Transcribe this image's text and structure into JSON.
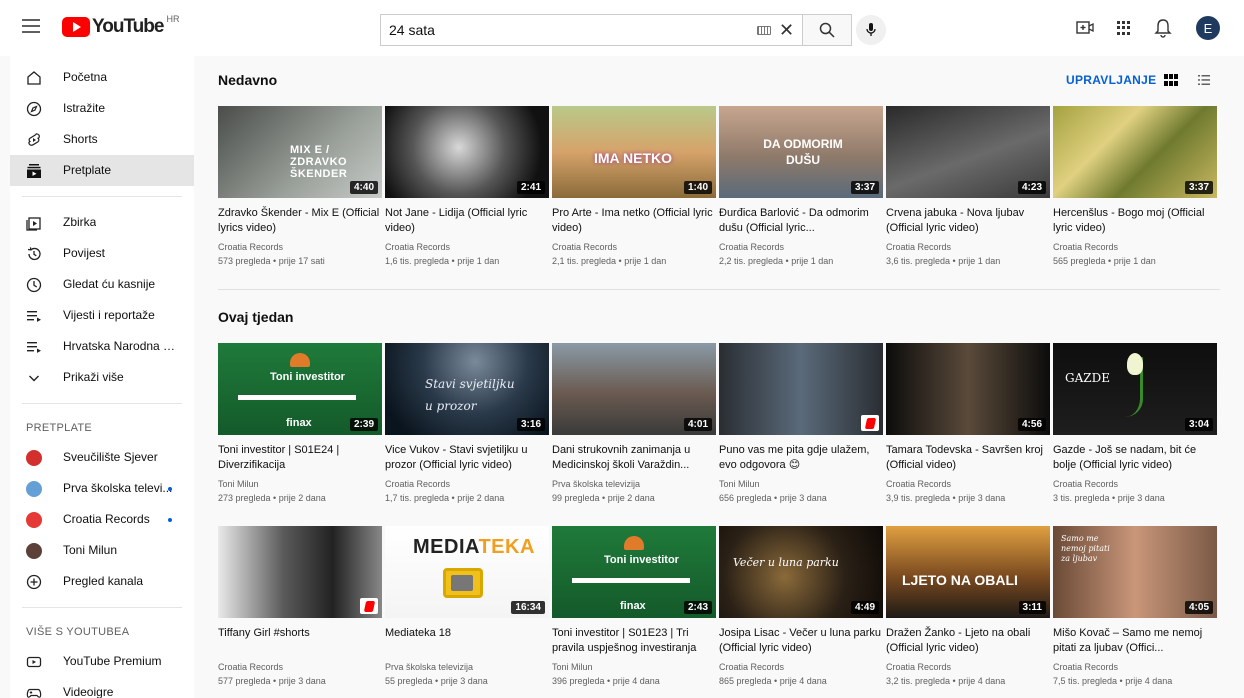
{
  "header": {
    "logo_text": "YouTube",
    "region": "HR",
    "search_value": "24 sata",
    "avatar_letter": "E"
  },
  "sidebar": {
    "main": [
      {
        "label": "Početna",
        "icon": "home-icon"
      },
      {
        "label": "Istražite",
        "icon": "compass-icon"
      },
      {
        "label": "Shorts",
        "icon": "shorts-icon"
      },
      {
        "label": "Pretplate",
        "icon": "subscriptions-icon",
        "active": true
      }
    ],
    "library": [
      {
        "label": "Zbirka",
        "icon": "library-icon"
      },
      {
        "label": "Povijest",
        "icon": "history-icon"
      },
      {
        "label": "Gledat ću kasnije",
        "icon": "clock-icon"
      },
      {
        "label": "Vijesti i reportaže",
        "icon": "playlist-icon"
      },
      {
        "label": "Hrvatska Narodna Gl...",
        "icon": "playlist-icon"
      },
      {
        "label": "Prikaži više",
        "icon": "chevron-down-icon"
      }
    ],
    "subs_heading": "PRETPLATE",
    "subscriptions": [
      {
        "label": "Sveučilište Sjever",
        "color": "#d32f2f",
        "dot": false
      },
      {
        "label": "Prva školska televi...",
        "color": "#64a0d6",
        "dot": true
      },
      {
        "label": "Croatia Records",
        "color": "#e53935",
        "dot": true
      },
      {
        "label": "Toni Milun",
        "color": "#5d4037",
        "dot": false
      },
      {
        "label": "Pregled kanala",
        "icon": "add-circle-icon",
        "dot": false
      }
    ],
    "more_heading": "VIŠE S YOUTUBEA",
    "more": [
      {
        "label": "YouTube Premium",
        "icon": "youtube-icon"
      },
      {
        "label": "Videoigre",
        "icon": "gamepad-icon"
      }
    ]
  },
  "main": {
    "manage_label": "UPRAVLJANJE",
    "sections": [
      {
        "title": "Nedavno",
        "rows": [
          [
            {
              "title": "Zdravko Škender - Mix E (Official lyrics video)",
              "channel": "Croatia Records",
              "meta": "573 pregleda • prije 17 sati",
              "duration": "4:40",
              "bg": "linear-gradient(135deg,#4a4d4a,#9aa09a 60%,#c8cbc8)",
              "overlay": "MIX E / ZDRAVKO ŠKENDER"
            },
            {
              "title": "Not Jane - Lidija (Official lyric video)",
              "channel": "Croatia Records",
              "meta": "1,6 tis. pregleda • prije 1 dan",
              "duration": "2:41",
              "bg": "radial-gradient(circle at 45% 45%,#d8d8d8,#555 45%,#111 80%)",
              "overlay": ""
            },
            {
              "title": "Pro Arte - Ima netko (Official lyric video)",
              "channel": "Croatia Records",
              "meta": "2,1 tis. pregleda • prije 1 dan",
              "duration": "1:40",
              "bg": "linear-gradient(180deg,#b9c98a,#d6a36a 50%,#8a6a3a)",
              "overlay": "IMA NETKO"
            },
            {
              "title": "Đurđica Barlović - Da odmorim dušu (Official lyric...",
              "channel": "Croatia Records",
              "meta": "2,2 tis. pregleda • prije 1 dan",
              "duration": "3:37",
              "bg": "linear-gradient(180deg,#c7a68f,#8f7a6a 55%,#5a6a7a)",
              "overlay": "DA ODMORIM DUŠU"
            },
            {
              "title": "Crvena jabuka - Nova ljubav (Official lyric video)",
              "channel": "Croatia Records",
              "meta": "3,6 tis. pregleda • prije 1 dan",
              "duration": "4:23",
              "bg": "linear-gradient(160deg,#2a2a2a,#6a6a6a 55%,#3a3a3a)",
              "overlay": ""
            },
            {
              "title": "Hercenšlus - Bogo moj (Official lyric video)",
              "channel": "Croatia Records",
              "meta": "565 pregleda • prije 1 dan",
              "duration": "3:37",
              "bg": "linear-gradient(135deg,#a4a240,#e0d080 35%,#6f7a2f 60%,#c9b860)",
              "overlay": ""
            }
          ]
        ]
      },
      {
        "title": "Ovaj tjedan",
        "rows": [
          [
            {
              "title": "Toni investitor | S01E24 | Diverzifikacija",
              "channel": "Toni Milun",
              "meta": "273 pregleda • prije 2 dana",
              "duration": "2:39",
              "bg": "linear-gradient(180deg,#1f7a3a,#145a2a)",
              "overlay": "Toni investitor"
            },
            {
              "title": "Vice Vukov - Stavi svjetiljku u prozor (Official lyric video)",
              "channel": "Croatia Records",
              "meta": "1,7 tis. pregleda • prije 2 dana",
              "duration": "3:16",
              "bg": "radial-gradient(circle at 55% 20%,#7a8a9a,#2a3a4a 45%,#0a141e 85%)",
              "overlay": "Stavi svjetiljku u prozor"
            },
            {
              "title": "Dani strukovnih zanimanja u Medicinskoj školi Varaždin...",
              "channel": "Prva školska televizija",
              "meta": "99 pregleda • prije 2 dana",
              "duration": "4:01",
              "bg": "linear-gradient(180deg,#8a9aa6,#6a5a50 55%,#3a3a3a)",
              "overlay": ""
            },
            {
              "title": "Puno vas me pita gdje ulažem, evo odgovora 😊",
              "channel": "Toni Milun",
              "meta": "656 pregleda • prije 3 dana",
              "duration": "",
              "shorts": true,
              "bg": "linear-gradient(90deg,#2a2e33,#5a6a7a 50%,#2a2e33)",
              "overlay": ""
            },
            {
              "title": "Tamara Todevska - Savršen kroj (Official video)",
              "channel": "Croatia Records",
              "meta": "3,9 tis. pregleda • prije 3 dana",
              "duration": "4:56",
              "bg": "linear-gradient(90deg,#0c0c0c,#5a4a3a 50%,#0c0c0c)",
              "overlay": ""
            },
            {
              "title": "Gazde - Još se nadam, bit će bolje (Official lyric video)",
              "channel": "Croatia Records",
              "meta": "3 tis. pregleda • prije 3 dana",
              "duration": "3:04",
              "bg": "linear-gradient(180deg,#0e0e0e,#1e1e1e)",
              "overlay": "GAZDE"
            }
          ],
          [
            {
              "title": "Tiffany Girl #shorts",
              "channel": "Croatia Records",
              "meta": "577 pregleda • prije 3 dana",
              "duration": "",
              "shorts": true,
              "bg": "linear-gradient(90deg,#eaeaea,#5a5a5a 40%,#222 70%,#888)",
              "overlay": ""
            },
            {
              "title": "Mediateka 18",
              "channel": "Prva školska televizija",
              "meta": "55 pregleda • prije 3 dana",
              "duration": "16:34",
              "bg": "linear-gradient(180deg,#ffffff,#f4f4f4)",
              "overlay": "MEDIATEKA"
            },
            {
              "title": "Toni investitor | S01E23 | Tri pravila uspješnog investiranja",
              "channel": "Toni Milun",
              "meta": "396 pregleda • prije 4 dana",
              "duration": "2:43",
              "bg": "linear-gradient(180deg,#1f7a3a,#145a2a)",
              "overlay": "Toni investitor"
            },
            {
              "title": "Josipa Lisac - Večer u luna parku (Official lyric video)",
              "channel": "Croatia Records",
              "meta": "865 pregleda • prije 4 dana",
              "duration": "4:49",
              "bg": "radial-gradient(circle at 40% 55%,#8a6a3a,#2a2016 55%,#0e0a06)",
              "overlay": "Večer u luna parku"
            },
            {
              "title": "Dražen Žanko - Ljeto na obali (Official lyric video)",
              "channel": "Croatia Records",
              "meta": "3,2 tis. pregleda • prije 4 dana",
              "duration": "3:11",
              "bg": "linear-gradient(180deg,#e0a040,#7a4a20 55%,#1e1a16)",
              "overlay": "LJETO NA OBALI"
            },
            {
              "title": "Mišo Kovač – Samo me nemoj pitati za ljubav (Offici...",
              "channel": "Croatia Records",
              "meta": "7,5 tis. pregleda • prije 4 dana",
              "duration": "4:05",
              "bg": "linear-gradient(90deg,#6a4a36,#c9967a 50%,#7a5a46)",
              "overlay": "Samo me nemoj pitati za ljubav"
            }
          ]
        ]
      }
    ]
  }
}
